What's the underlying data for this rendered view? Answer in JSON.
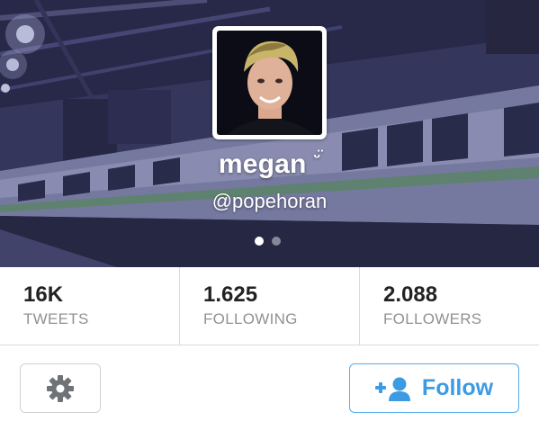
{
  "profile": {
    "name": "megan",
    "name_emoticon": "ᵕ̈",
    "handle": "@popehoran",
    "banner_page_index": 1,
    "banner_page_count": 2
  },
  "stats": [
    {
      "value": "16K",
      "label": "TWEETS"
    },
    {
      "value": "1.625",
      "label": "FOLLOWING"
    },
    {
      "value": "2.088",
      "label": "FOLLOWERS"
    }
  ],
  "actions": {
    "settings_icon": "gear-icon",
    "follow_icon": "add-user-icon",
    "follow_label": "Follow"
  },
  "colors": {
    "accent": "#55acee",
    "stat_label": "#8f9193",
    "banner_tint": "#3a3a66"
  }
}
